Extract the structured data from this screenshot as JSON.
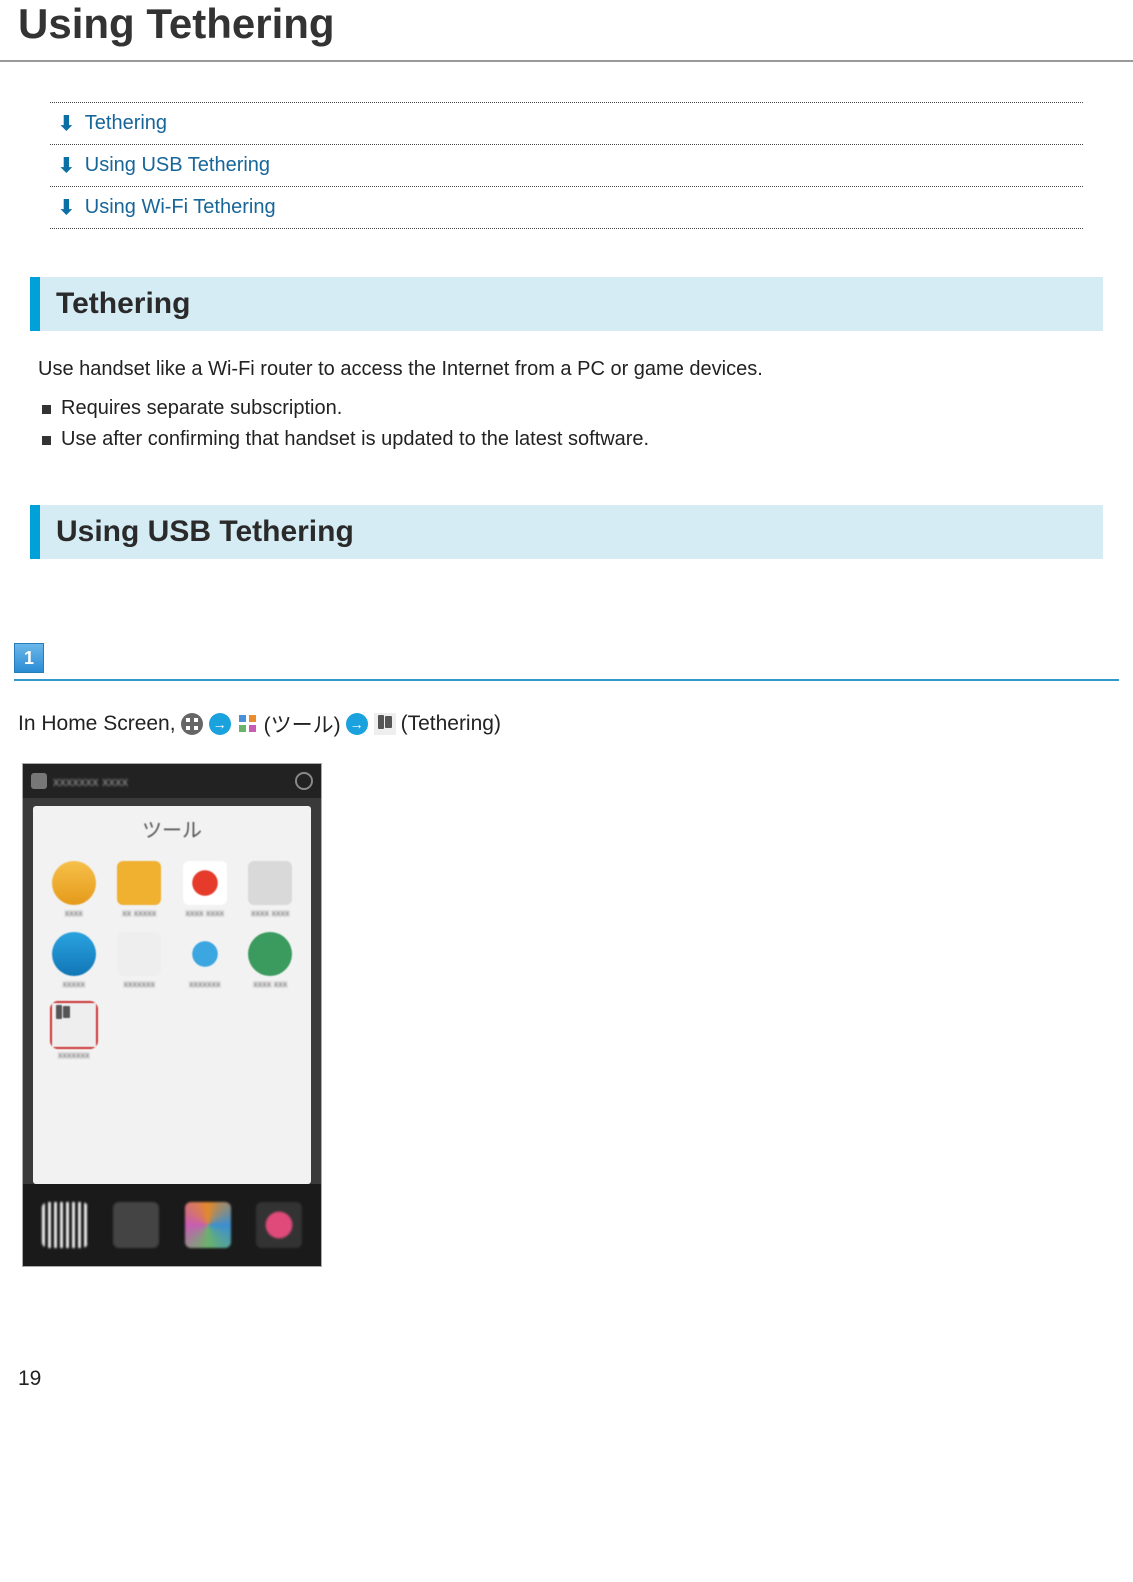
{
  "page": {
    "title": "Using Tethering",
    "number": "19"
  },
  "toc": {
    "items": [
      {
        "label": "Tethering"
      },
      {
        "label": "Using USB Tethering"
      },
      {
        "label": "Using Wi-Fi Tethering"
      }
    ]
  },
  "section_tethering": {
    "heading": "Tethering",
    "intro": "Use handset like a Wi-Fi router to access the Internet from a PC or game devices.",
    "bullets": [
      "Requires separate subscription.",
      "Use after confirming that handset is updated to the latest software."
    ]
  },
  "section_usb": {
    "heading": "Using USB Tethering",
    "step1": {
      "badge": "1",
      "prefix": "In Home Screen, ",
      "jp_group": " (ツール)",
      "tethering_label": " (Tethering)"
    }
  },
  "screenshot": {
    "card_title": "ツール"
  }
}
